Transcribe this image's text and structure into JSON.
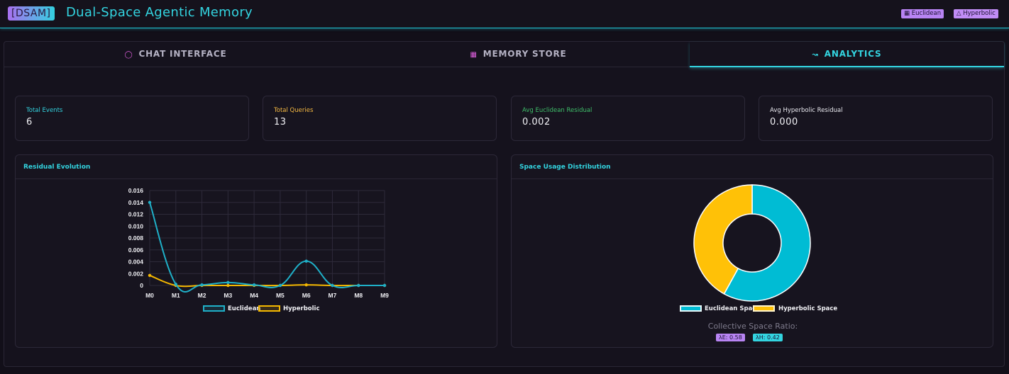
{
  "header": {
    "badge": "[DSAM]",
    "title": "Dual-Space Agentic Memory",
    "tags": [
      {
        "icon": "grid-icon",
        "label": "Euclidean"
      },
      {
        "icon": "hierarchy-icon",
        "label": "Hyperbolic"
      }
    ]
  },
  "tabs": [
    {
      "label": "CHAT INTERFACE",
      "icon": "chat-icon",
      "active": false
    },
    {
      "label": "MEMORY STORE",
      "icon": "table-icon",
      "active": false
    },
    {
      "label": "ANALYTICS",
      "icon": "line-chart-icon",
      "active": true
    }
  ],
  "stats": [
    {
      "label": "Total Events",
      "value": "6",
      "color": "#33d4e0"
    },
    {
      "label": "Total Queries",
      "value": "13",
      "color": "#f5b942"
    },
    {
      "label": "Avg Euclidean Residual",
      "value": "0.002",
      "color": "#3fbf6a"
    },
    {
      "label": "Avg Hyperbolic Residual",
      "value": "0.000",
      "color": "#e8e8ee"
    }
  ],
  "residual_card": {
    "title": "Residual Evolution"
  },
  "usage_card": {
    "title": "Space Usage Distribution",
    "ratio_label": "Collective Space Ratio:",
    "ratio_pills": [
      "λE: 0.58",
      "λH: 0.42"
    ]
  },
  "colors": {
    "euclidean": "#1fb0c8",
    "hyperbolic": "#f5b800",
    "accent": "#33d4e0"
  },
  "chart_data": [
    {
      "type": "line",
      "title": "",
      "x": [
        "M0",
        "M1",
        "M2",
        "M3",
        "M4",
        "M5",
        "M6",
        "M7",
        "M8",
        "M9"
      ],
      "ylim": [
        0,
        0.016
      ],
      "yticks": [
        "0",
        "0.002",
        "0.004",
        "0.006",
        "0.008",
        "0.010",
        "0.012",
        "0.014",
        "0.016"
      ],
      "grid": true,
      "legend": "bottom",
      "series": [
        {
          "name": "Euclidean",
          "values": [
            0.014,
            0.0002,
            0.0001,
            0.0005,
            0.0001,
            0.0,
            0.0041,
            0.0,
            0.0,
            0.0
          ],
          "color": "#1fb0c8"
        },
        {
          "name": "Hyperbolic",
          "values": [
            0.0017,
            0.0,
            0.0,
            0.0,
            0.0,
            0.0,
            0.0001,
            0.0,
            0.0,
            0.0
          ],
          "color": "#f5b800"
        }
      ]
    },
    {
      "type": "pie",
      "title": "",
      "legend": "bottom",
      "categories": [
        "Euclidean Space",
        "Hyperbolic Space"
      ],
      "values": [
        0.58,
        0.42
      ],
      "colors": [
        "#00bcd4",
        "#ffc107"
      ]
    }
  ]
}
